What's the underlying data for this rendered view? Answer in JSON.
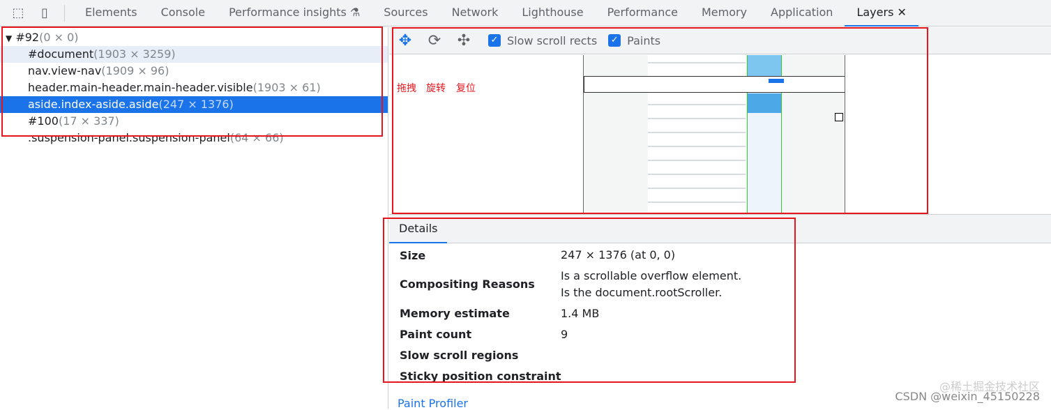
{
  "toolbar": {
    "tabs": [
      "Elements",
      "Console",
      "Performance insights",
      "Sources",
      "Network",
      "Lighthouse",
      "Performance",
      "Memory",
      "Application",
      "Layers"
    ],
    "active": "Layers",
    "close": "✕"
  },
  "layers": [
    {
      "name": "#92",
      "size": "(0 × 0)"
    },
    {
      "name": "#document",
      "size": "(1903 × 3259)"
    },
    {
      "name": "nav.view-nav",
      "size": "(1909 × 96)"
    },
    {
      "name": "header.main-header.main-header.visible",
      "size": "(1903 × 61)"
    },
    {
      "name": "aside.index-aside.aside",
      "size": "(247 × 1376)"
    },
    {
      "name": "#100",
      "size": "(17 × 337)"
    },
    {
      "name": ".suspension-panel.suspension-panel",
      "size": "(64 × 66)"
    }
  ],
  "layer_toolbar": {
    "slow_scroll_rects": "Slow scroll rects",
    "paints": "Paints",
    "slow_checked": true,
    "paints_checked": true
  },
  "annotations": {
    "pan": "拖拽",
    "rotate": "旋转",
    "reset": "复位"
  },
  "details": {
    "tab": "Details",
    "rows": [
      {
        "k": "Size",
        "v": "247 × 1376 (at 0, 0)"
      },
      {
        "k": "Compositing Reasons",
        "v": "Is a scrollable overflow element.",
        "v2": "Is the document.rootScroller."
      },
      {
        "k": "Memory estimate",
        "v": "1.4 MB"
      },
      {
        "k": "Paint count",
        "v": "9"
      },
      {
        "k": "Slow scroll regions",
        "v": ""
      },
      {
        "k": "Sticky position constraint",
        "v": ""
      }
    ],
    "paint_profiler": "Paint Profiler"
  },
  "watermark": {
    "line1": "@稀土掘金技术社区",
    "line2": "CSDN @weixin_45150228"
  }
}
